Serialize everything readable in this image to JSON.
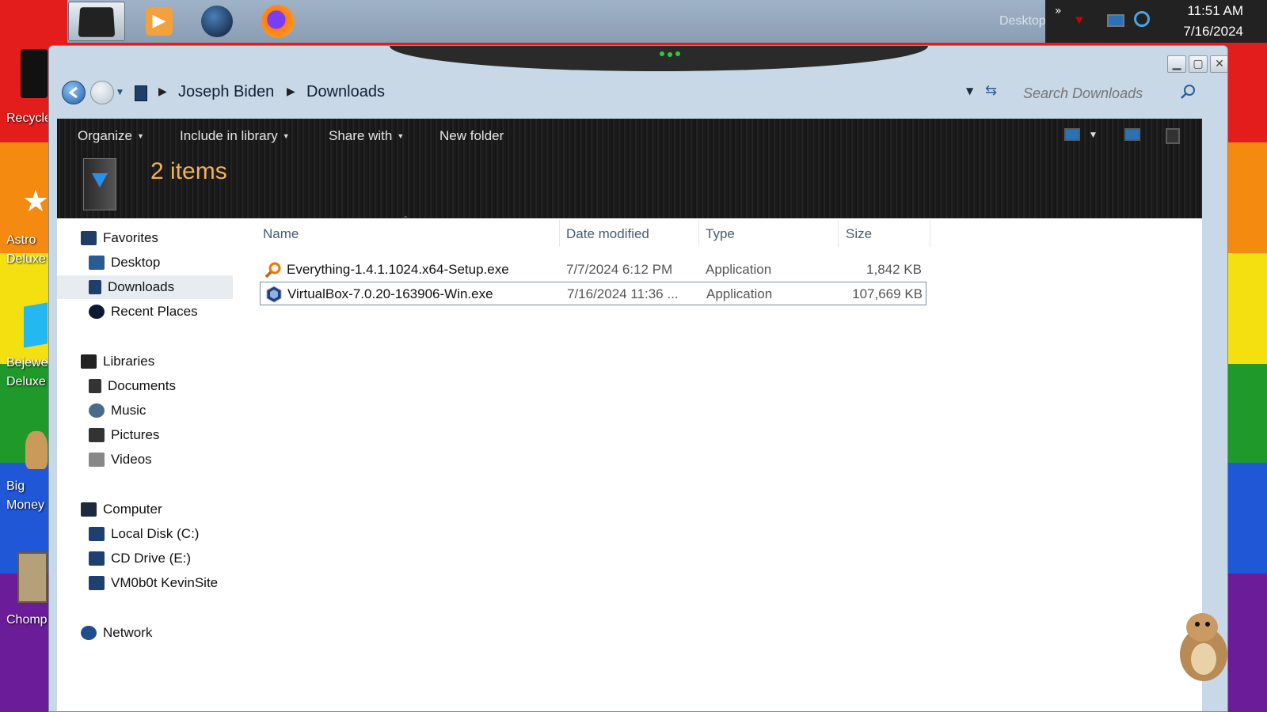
{
  "taskbar": {
    "apps": [
      "terminal-app",
      "media-player-app",
      "globe-app",
      "firefox-app"
    ],
    "tray_label": "Desktop",
    "clock_time": "11:51 AM",
    "clock_date": "7/16/2024"
  },
  "desktop_icons": [
    {
      "label": "Recycle Bin",
      "icon": "recycle-bin-icon"
    },
    {
      "label": "Astro Deluxe",
      "icon": "star-icon"
    },
    {
      "label": "Bejeweled Deluxe",
      "icon": "gem-icon"
    },
    {
      "label": "Big Money Deluxe",
      "icon": "money-bag-icon"
    },
    {
      "label": "Chomp",
      "icon": "chomp-icon"
    }
  ],
  "window": {
    "breadcrumb": [
      "Joseph Biden",
      "Downloads"
    ],
    "search_placeholder": "Search Downloads",
    "commands": [
      "Organize",
      "Include in library",
      "Share with",
      "New folder"
    ],
    "items_count": "2 items"
  },
  "nav": {
    "favorites": {
      "label": "Favorites",
      "items": [
        "Desktop",
        "Downloads",
        "Recent Places"
      ]
    },
    "libraries": {
      "label": "Libraries",
      "items": [
        "Documents",
        "Music",
        "Pictures",
        "Videos"
      ]
    },
    "computer": {
      "label": "Computer",
      "items": [
        "Local Disk (C:)",
        "CD Drive (E:)",
        "VM0b0t KevinSite"
      ]
    },
    "network": {
      "label": "Network"
    }
  },
  "columns": {
    "name": "Name",
    "date": "Date modified",
    "type": "Type",
    "size": "Size"
  },
  "files": [
    {
      "name": "Everything-1.4.1.1024.x64-Setup.exe",
      "date": "7/7/2024 6:12 PM",
      "type": "Application",
      "size": "1,842 KB",
      "icon": "magnifier-icon"
    },
    {
      "name": "VirtualBox-7.0.20-163906-Win.exe",
      "date": "7/16/2024 11:36 ...",
      "type": "Application",
      "size": "107,669 KB",
      "icon": "virtualbox-icon"
    }
  ],
  "colors": {
    "items_count": "#f2b25b",
    "header_text": "#4a5b70"
  }
}
